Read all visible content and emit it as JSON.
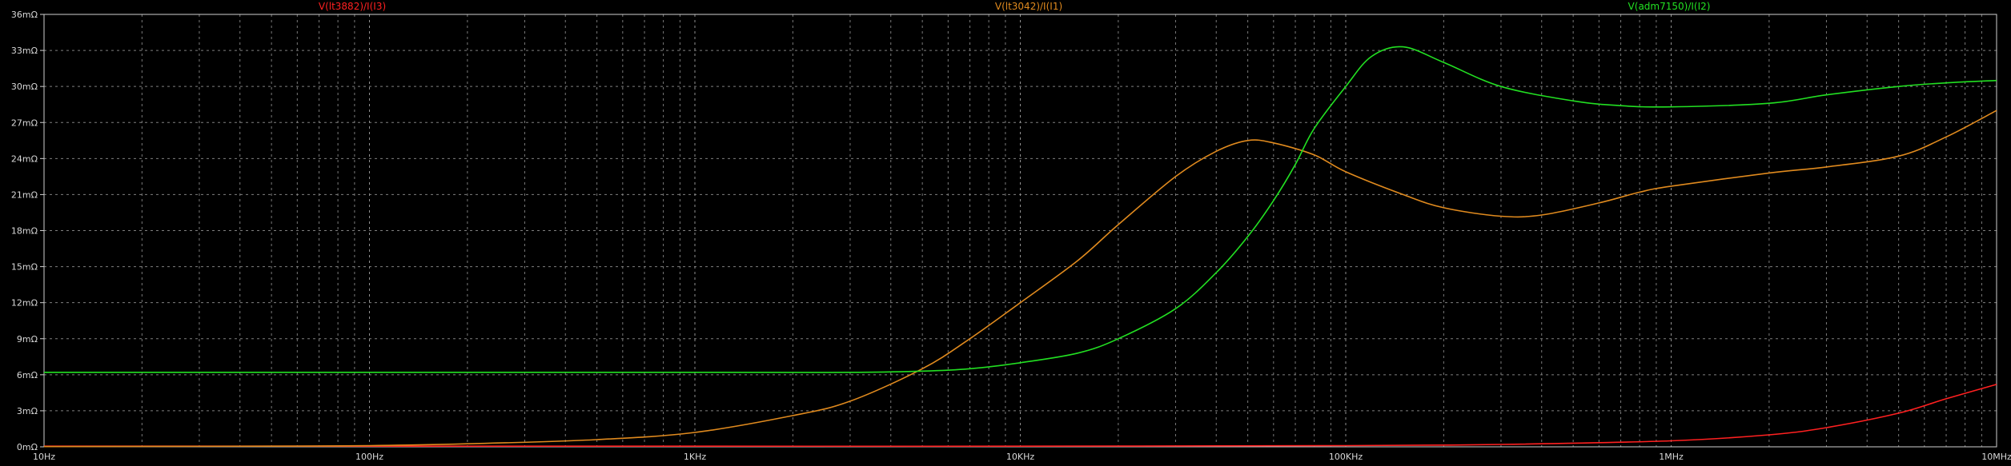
{
  "chart_data": {
    "type": "line",
    "xscale": "log",
    "xlim": [
      10,
      10000000
    ],
    "ylim": [
      0,
      36
    ],
    "yunit": "mΩ",
    "x_ticks": [
      "10Hz",
      "100Hz",
      "1KHz",
      "10KHz",
      "100KHz",
      "1MHz",
      "10MHz"
    ],
    "y_ticks": [
      "0mΩ",
      "3mΩ",
      "6mΩ",
      "9mΩ",
      "12mΩ",
      "15mΩ",
      "18mΩ",
      "21mΩ",
      "24mΩ",
      "27mΩ",
      "30mΩ",
      "33mΩ",
      "36mΩ"
    ],
    "grid": true,
    "series": [
      {
        "name": "V(lt3882)/I(I3)",
        "color": "#ff2020",
        "points": [
          [
            10,
            0.05
          ],
          [
            1000,
            0.05
          ],
          [
            10000,
            0.05
          ],
          [
            100000,
            0.1
          ],
          [
            300000,
            0.2
          ],
          [
            1000000,
            0.5
          ],
          [
            2000000,
            1.0
          ],
          [
            3000000,
            1.6
          ],
          [
            5000000,
            2.8
          ],
          [
            7000000,
            4.0
          ],
          [
            10000000,
            5.2
          ]
        ]
      },
      {
        "name": "V(lt3042)/I(I1)",
        "color": "#e08a1e",
        "points": [
          [
            10,
            0.02
          ],
          [
            50,
            0.05
          ],
          [
            100,
            0.1
          ],
          [
            200,
            0.25
          ],
          [
            500,
            0.6
          ],
          [
            1000,
            1.2
          ],
          [
            2000,
            2.6
          ],
          [
            3000,
            3.8
          ],
          [
            5000,
            6.5
          ],
          [
            7000,
            9.0
          ],
          [
            10000,
            12.0
          ],
          [
            15000,
            15.5
          ],
          [
            20000,
            18.5
          ],
          [
            30000,
            22.5
          ],
          [
            40000,
            24.6
          ],
          [
            50000,
            25.5
          ],
          [
            60000,
            25.3
          ],
          [
            80000,
            24.3
          ],
          [
            100000,
            22.9
          ],
          [
            150000,
            21.0
          ],
          [
            200000,
            19.9
          ],
          [
            300000,
            19.2
          ],
          [
            400000,
            19.3
          ],
          [
            600000,
            20.3
          ],
          [
            800000,
            21.2
          ],
          [
            1000000,
            21.7
          ],
          [
            2000000,
            22.8
          ],
          [
            3000000,
            23.3
          ],
          [
            5000000,
            24.2
          ],
          [
            7000000,
            25.8
          ],
          [
            10000000,
            28.0
          ]
        ]
      },
      {
        "name": "V(adm7150)/I(I2)",
        "color": "#22e022",
        "points": [
          [
            10,
            6.2
          ],
          [
            1000,
            6.2
          ],
          [
            3000,
            6.2
          ],
          [
            5000,
            6.3
          ],
          [
            7000,
            6.5
          ],
          [
            10000,
            7.0
          ],
          [
            15000,
            7.8
          ],
          [
            20000,
            9.0
          ],
          [
            30000,
            11.5
          ],
          [
            40000,
            14.5
          ],
          [
            50000,
            17.5
          ],
          [
            60000,
            20.5
          ],
          [
            70000,
            23.5
          ],
          [
            80000,
            26.5
          ],
          [
            100000,
            30.0
          ],
          [
            120000,
            32.5
          ],
          [
            150000,
            33.3
          ],
          [
            200000,
            32.0
          ],
          [
            300000,
            30.0
          ],
          [
            500000,
            28.8
          ],
          [
            700000,
            28.4
          ],
          [
            1000000,
            28.3
          ],
          [
            2000000,
            28.6
          ],
          [
            3000000,
            29.3
          ],
          [
            5000000,
            30.0
          ],
          [
            7000000,
            30.3
          ],
          [
            10000000,
            30.5
          ]
        ]
      }
    ]
  }
}
